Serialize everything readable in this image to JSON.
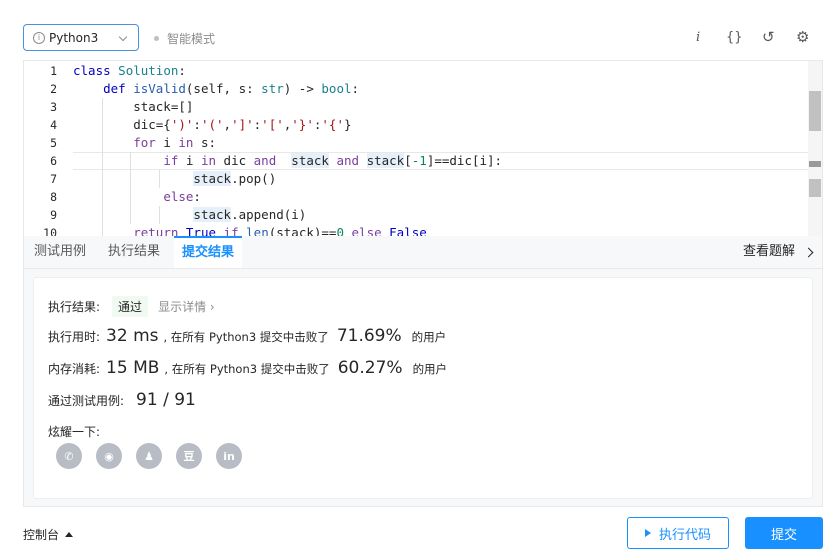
{
  "toolbar": {
    "language": "Python3",
    "info_glyph": "i",
    "smart_mode": "智能模式",
    "icons": [
      "info-icon",
      "braces-icon",
      "reset-icon",
      "settings-icon"
    ],
    "italic_i": "i",
    "braces": "{}",
    "reset_glyph": "↺",
    "settings_glyph": "⚙"
  },
  "editor": {
    "line_numbers": [
      "1",
      "2",
      "3",
      "4",
      "5",
      "6",
      "7",
      "8",
      "9",
      "10"
    ]
  },
  "tabs": {
    "testcase": "测试用例",
    "run_result": "执行结果",
    "submit_result": "提交结果",
    "view_solution": "查看题解"
  },
  "result": {
    "status_label": "执行结果:",
    "status_value": "通过",
    "detail": "显示详情 ›",
    "time_label": "执行用时:",
    "time_value": "32 ms",
    "time_middle": ", 在所有 Python3 提交中击败了",
    "time_percent": "71.69%",
    "users": "的用户",
    "mem_label": "内存消耗:",
    "mem_value": "15 MB",
    "mem_middle": ", 在所有 Python3 提交中击败了",
    "mem_percent": "60.27%",
    "tests_label": "通过测试用例:",
    "tests_value": "91 / 91",
    "share_label": "炫耀一下:",
    "share_glyphs": [
      "✆",
      "◉",
      "♟",
      "豆",
      "in"
    ]
  },
  "bottom": {
    "console": "控制台",
    "run": "执行代码",
    "submit": "提交"
  },
  "colors": {
    "accent": "#1890ff",
    "pass_bg": "#f0faf0"
  }
}
